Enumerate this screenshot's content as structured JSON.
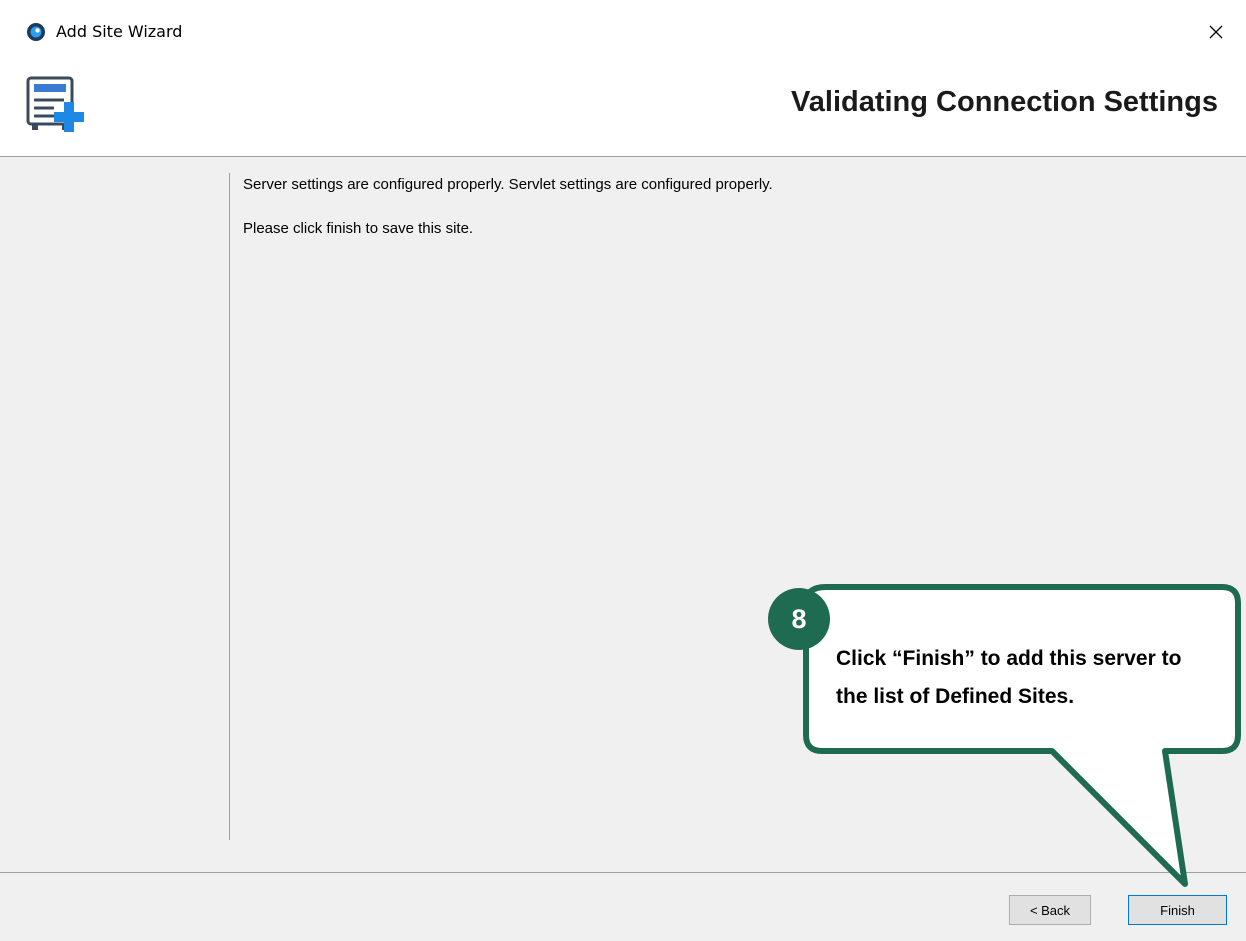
{
  "window": {
    "title": "Add Site Wizard",
    "close_glyph": "✕"
  },
  "header": {
    "heading": "Validating Connection Settings"
  },
  "content": {
    "line1": "Server settings are configured properly. Servlet settings are configured properly.",
    "line2": "Please click finish to save this site."
  },
  "buttons": {
    "back": "< Back",
    "finish": "Finish"
  },
  "callout": {
    "step": "8",
    "text": "Click “Finish” to add this server to the list of Defined Sites."
  },
  "colors": {
    "callout_border": "#1f6b52",
    "badge": "#1f6b52",
    "accent_blue": "#0078d7"
  },
  "icons": {
    "app": "app-logo-icon",
    "header": "server-add-icon",
    "close": "close-icon"
  }
}
